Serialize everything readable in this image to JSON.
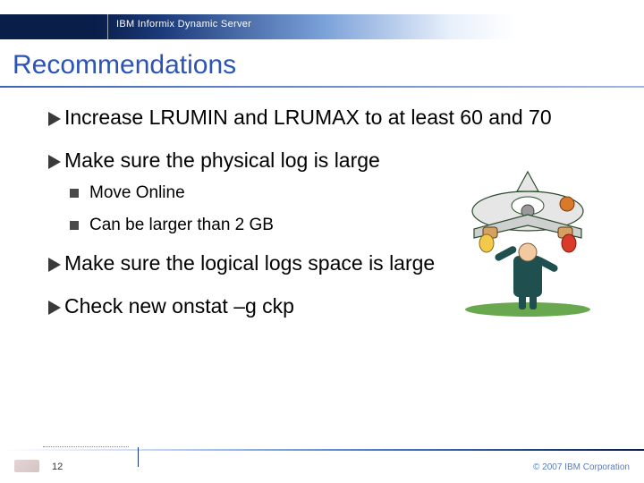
{
  "header": {
    "product": "IBM Informix Dynamic Server"
  },
  "title": "Recommendations",
  "bullets": [
    {
      "text": "Increase LRUMIN and LRUMAX to at least 60 and 70",
      "sub": []
    },
    {
      "text": "Make sure the physical log is large",
      "sub": [
        {
          "text": "Move Online"
        },
        {
          "text": "Can be larger than 2 GB"
        }
      ]
    },
    {
      "text": "Make sure the logical logs space is large",
      "sub": []
    },
    {
      "text": "Check new onstat –g ckp",
      "sub": []
    }
  ],
  "footer": {
    "page": "12",
    "copyright": "© 2007 IBM Corporation"
  }
}
